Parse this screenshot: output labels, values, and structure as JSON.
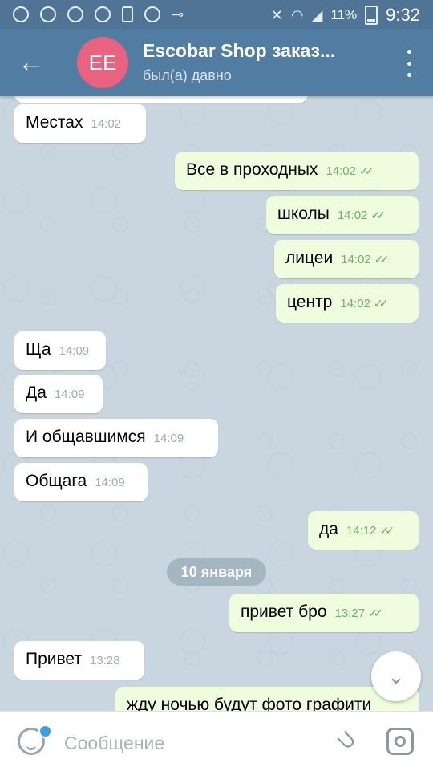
{
  "status_bar": {
    "battery": "11%",
    "time": "9:32"
  },
  "header": {
    "avatar_initials": "EE",
    "title": "Escobar Shop заказ...",
    "subtitle": "был(а) давно",
    "avatar_color": "#e96280"
  },
  "messages": [
    {
      "text": "",
      "time": "",
      "dir": "in"
    },
    {
      "text": "Местах",
      "time": "14:02",
      "dir": "in"
    },
    {
      "text": "Все в проходных",
      "time": "14:02",
      "dir": "out"
    },
    {
      "text": "школы",
      "time": "14:02",
      "dir": "out"
    },
    {
      "text": "лицеи",
      "time": "14:02",
      "dir": "out"
    },
    {
      "text": "центр",
      "time": "14:02",
      "dir": "out"
    },
    {
      "text": "Ща",
      "time": "14:09",
      "dir": "in"
    },
    {
      "text": "Да",
      "time": "14:09",
      "dir": "in"
    },
    {
      "text": "И общавшимся",
      "time": "14:09",
      "dir": "in"
    },
    {
      "text": "Общага",
      "time": "14:09",
      "dir": "in"
    },
    {
      "text": "да",
      "time": "14:12",
      "dir": "out"
    },
    {
      "text": "привет бро",
      "time": "13:27",
      "dir": "out"
    },
    {
      "text": "Привет",
      "time": "13:28",
      "dir": "in"
    },
    {
      "text": "жду ночью будут фото графити",
      "time": "",
      "dir": "out"
    }
  ],
  "date_separator": "10 января",
  "input": {
    "placeholder": "Сообщение"
  },
  "colors": {
    "header": "#527da3",
    "outgoing_bubble": "#effdde",
    "incoming_bubble": "#ffffff"
  },
  "icons": [
    "back-arrow-icon",
    "more-vert-icon",
    "emoji-icon",
    "attach-icon",
    "camera-icon",
    "chevron-down-icon"
  ]
}
